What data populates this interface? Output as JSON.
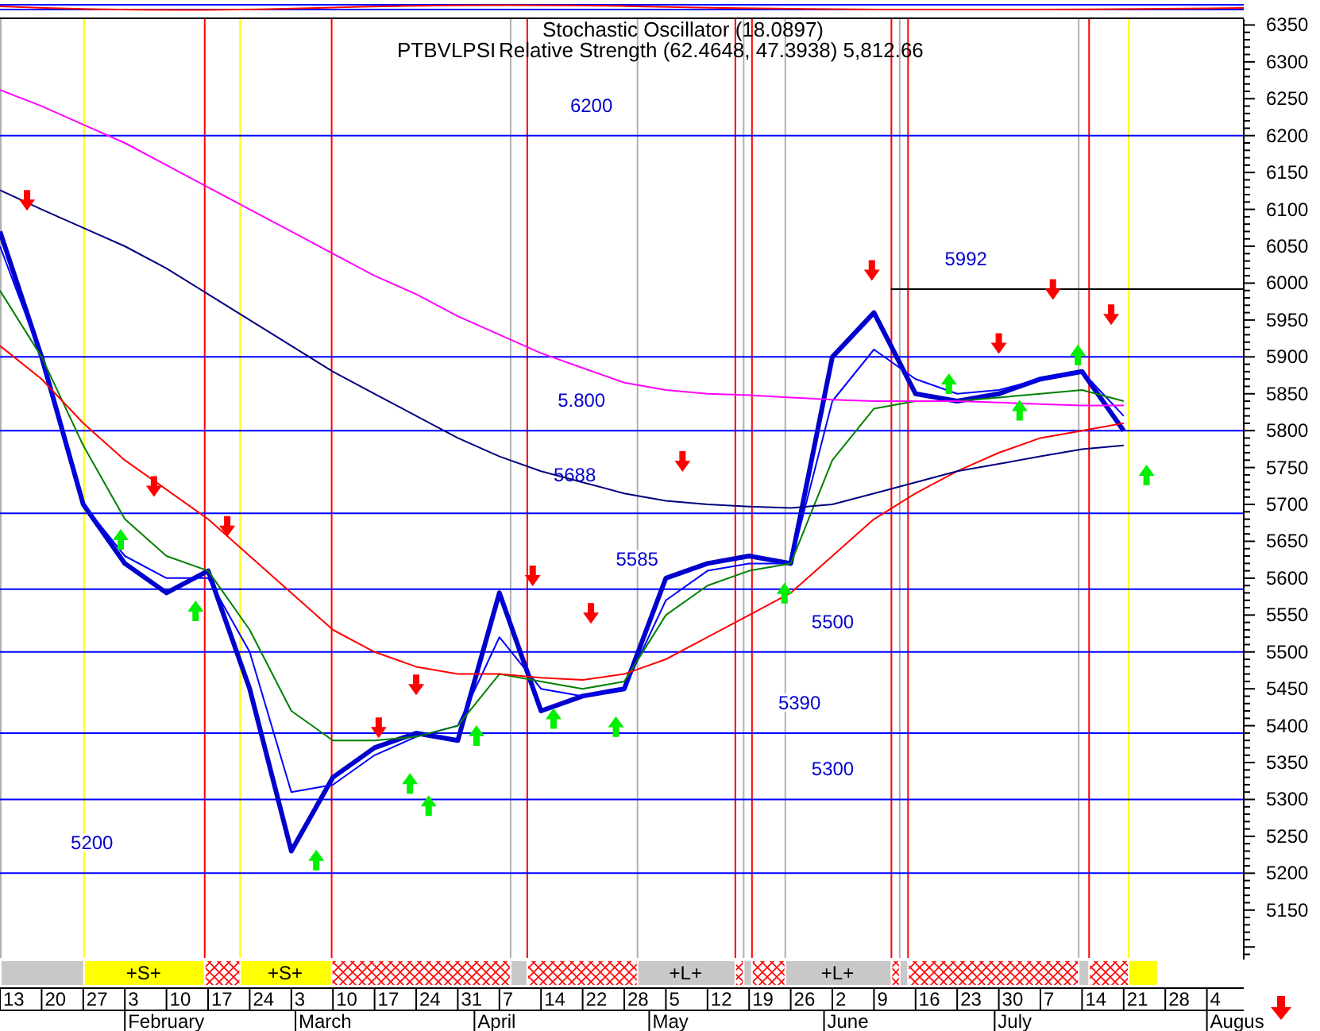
{
  "header": {
    "indicator": "Stochastic Oscillator (18.0897)",
    "symbol": "PTBVLPSI",
    "reading": "Relative Strength (62.4648, 47.3938) 5,812.66"
  },
  "chart_data": {
    "type": "line",
    "ylim": [
      5083,
      6358
    ],
    "categories": [
      "13",
      "20",
      "27",
      "3",
      "10",
      "17",
      "24",
      "3",
      "10",
      "17",
      "24",
      "31",
      "7",
      "14",
      "22",
      "28",
      "5",
      "12",
      "19",
      "26",
      "2",
      "9",
      "16",
      "23",
      "30",
      "7",
      "14",
      "21",
      "28",
      "4"
    ],
    "series": [
      {
        "color": "#0000cc",
        "values": [
          6070,
          5900,
          5700,
          5620,
          5580,
          5610,
          5450,
          5230,
          5330,
          5370,
          5390,
          5380,
          5580,
          5420,
          5440,
          5450,
          5600,
          5620,
          5630,
          5620,
          5900,
          5960,
          5850,
          5840,
          5850,
          5870,
          5880,
          5800,
          null,
          null
        ]
      },
      {
        "color": "#0000ff",
        "values": [
          6050,
          5900,
          5700,
          5630,
          5600,
          5600,
          5500,
          5310,
          5320,
          5360,
          5385,
          5400,
          5520,
          5450,
          5440,
          5450,
          5570,
          5610,
          5620,
          5620,
          5840,
          5910,
          5870,
          5850,
          5855,
          5870,
          5880,
          5820,
          null,
          null
        ]
      },
      {
        "color": "#008000",
        "values": [
          5990,
          5900,
          5780,
          5680,
          5630,
          5610,
          5530,
          5420,
          5380,
          5380,
          5385,
          5400,
          5470,
          5460,
          5450,
          5460,
          5550,
          5590,
          5610,
          5620,
          5760,
          5830,
          5840,
          5840,
          5845,
          5850,
          5855,
          5840,
          null,
          null
        ]
      },
      {
        "color": "#ff0000",
        "values": [
          5915,
          5870,
          5810,
          5760,
          5720,
          5680,
          5630,
          5580,
          5530,
          5500,
          5480,
          5470,
          5470,
          5465,
          5462,
          5470,
          5490,
          5520,
          5550,
          5580,
          5630,
          5680,
          5715,
          5745,
          5770,
          5790,
          5800,
          5810,
          null,
          null
        ]
      },
      {
        "color": "#000080",
        "values": [
          6126,
          6100,
          6075,
          6050,
          6020,
          5985,
          5950,
          5915,
          5880,
          5850,
          5820,
          5790,
          5765,
          5745,
          5730,
          5715,
          5705,
          5700,
          5697,
          5695,
          5700,
          5715,
          5730,
          5745,
          5755,
          5765,
          5775,
          5780,
          null,
          null
        ]
      },
      {
        "color": "#ff00ff",
        "values": [
          6262,
          6240,
          6215,
          6190,
          6160,
          6130,
          6100,
          6070,
          6040,
          6010,
          5985,
          5955,
          5930,
          5905,
          5885,
          5865,
          5855,
          5850,
          5848,
          5845,
          5842,
          5840,
          5840,
          5840,
          5838,
          5836,
          5834,
          5834,
          null,
          null
        ]
      }
    ],
    "grid": true,
    "yticks": [
      5150,
      5200,
      5250,
      5300,
      5350,
      5400,
      5450,
      5500,
      5550,
      5600,
      5650,
      5700,
      5750,
      5800,
      5850,
      5900,
      5950,
      6000,
      6050,
      6100,
      6150,
      6200,
      6250,
      6300,
      6350
    ],
    "ref_lines": [
      {
        "axis": "y",
        "value": 6200,
        "label": "6200"
      },
      {
        "axis": "y",
        "value": 5992,
        "label": "5992"
      },
      {
        "axis": "y",
        "value": 5900
      },
      {
        "axis": "y",
        "value": 5800
      },
      {
        "axis": "y",
        "value": 5688,
        "label": "5688"
      },
      {
        "axis": "y",
        "value": 5585,
        "label": "5585"
      },
      {
        "axis": "y",
        "value": 5500,
        "label": "5500"
      },
      {
        "axis": "y",
        "value": 5390,
        "label": "5390"
      },
      {
        "axis": "y",
        "value": 5300,
        "label": "5300"
      },
      {
        "axis": "y",
        "value": 5200,
        "label": "5200"
      }
    ]
  },
  "level_note": "5.800",
  "months": [
    "February",
    "March",
    "April",
    "May",
    "June",
    "July",
    "Augus"
  ],
  "signal_band": [
    {
      "kind": "flat"
    },
    {
      "kind": "long",
      "label": "+S+"
    },
    {
      "kind": "hatch"
    },
    {
      "kind": "long",
      "label": "+S+"
    },
    {
      "kind": "hatch"
    },
    {
      "kind": "flat"
    },
    {
      "kind": "hatch"
    },
    {
      "kind": "flat",
      "label": "+L+"
    },
    {
      "kind": "hatch"
    },
    {
      "kind": "flat"
    },
    {
      "kind": "hatch"
    },
    {
      "kind": "flat",
      "label": "+L+"
    },
    {
      "kind": "hatch"
    },
    {
      "kind": "flat"
    },
    {
      "kind": "hatch"
    },
    {
      "kind": "flat"
    },
    {
      "kind": "hatch"
    },
    {
      "kind": "long"
    }
  ]
}
